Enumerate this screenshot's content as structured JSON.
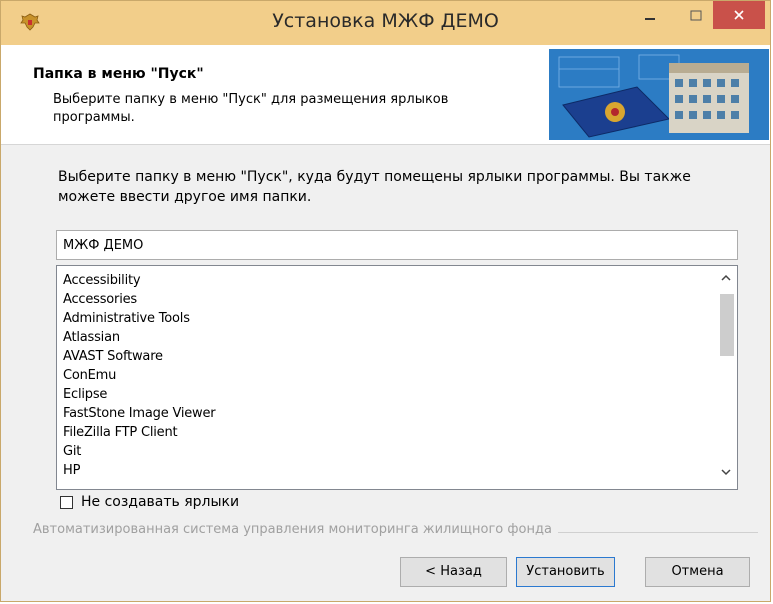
{
  "window": {
    "title": "Установка МЖФ ДЕМО"
  },
  "header": {
    "title": "Папка в меню \"Пуск\"",
    "subtitle": "Выберите папку в меню \"Пуск\" для размещения ярлыков программы."
  },
  "body": {
    "instruction": "Выберите папку в меню \"Пуск\", куда будут помещены ярлыки программы. Вы также можете ввести другое имя папки.",
    "folder_value": "МЖФ ДЕМО",
    "folders": [
      "Accessibility",
      "Accessories",
      "Administrative Tools",
      "Atlassian",
      "AVAST Software",
      "ConEmu",
      "Eclipse",
      "FastStone Image Viewer",
      "FileZilla FTP Client",
      "Git",
      "HP"
    ],
    "scroll_fraction": 0.0,
    "no_shortcuts_label": "Не создавать ярлыки",
    "no_shortcuts_checked": false
  },
  "footer": {
    "brand_text": "Автоматизированная система управления мониторинга жилищного фонда",
    "back_label": "< Назад",
    "install_label": "Установить",
    "cancel_label": "Отмена"
  },
  "colors": {
    "titlebar": "#f2ce8a",
    "close_button": "#c9514a",
    "default_button_border": "#2b79d0"
  },
  "icons": [
    "coat-of-arms-icon",
    "minimize-icon",
    "maximize-icon",
    "close-icon",
    "scroll-up-icon",
    "scroll-down-icon"
  ]
}
